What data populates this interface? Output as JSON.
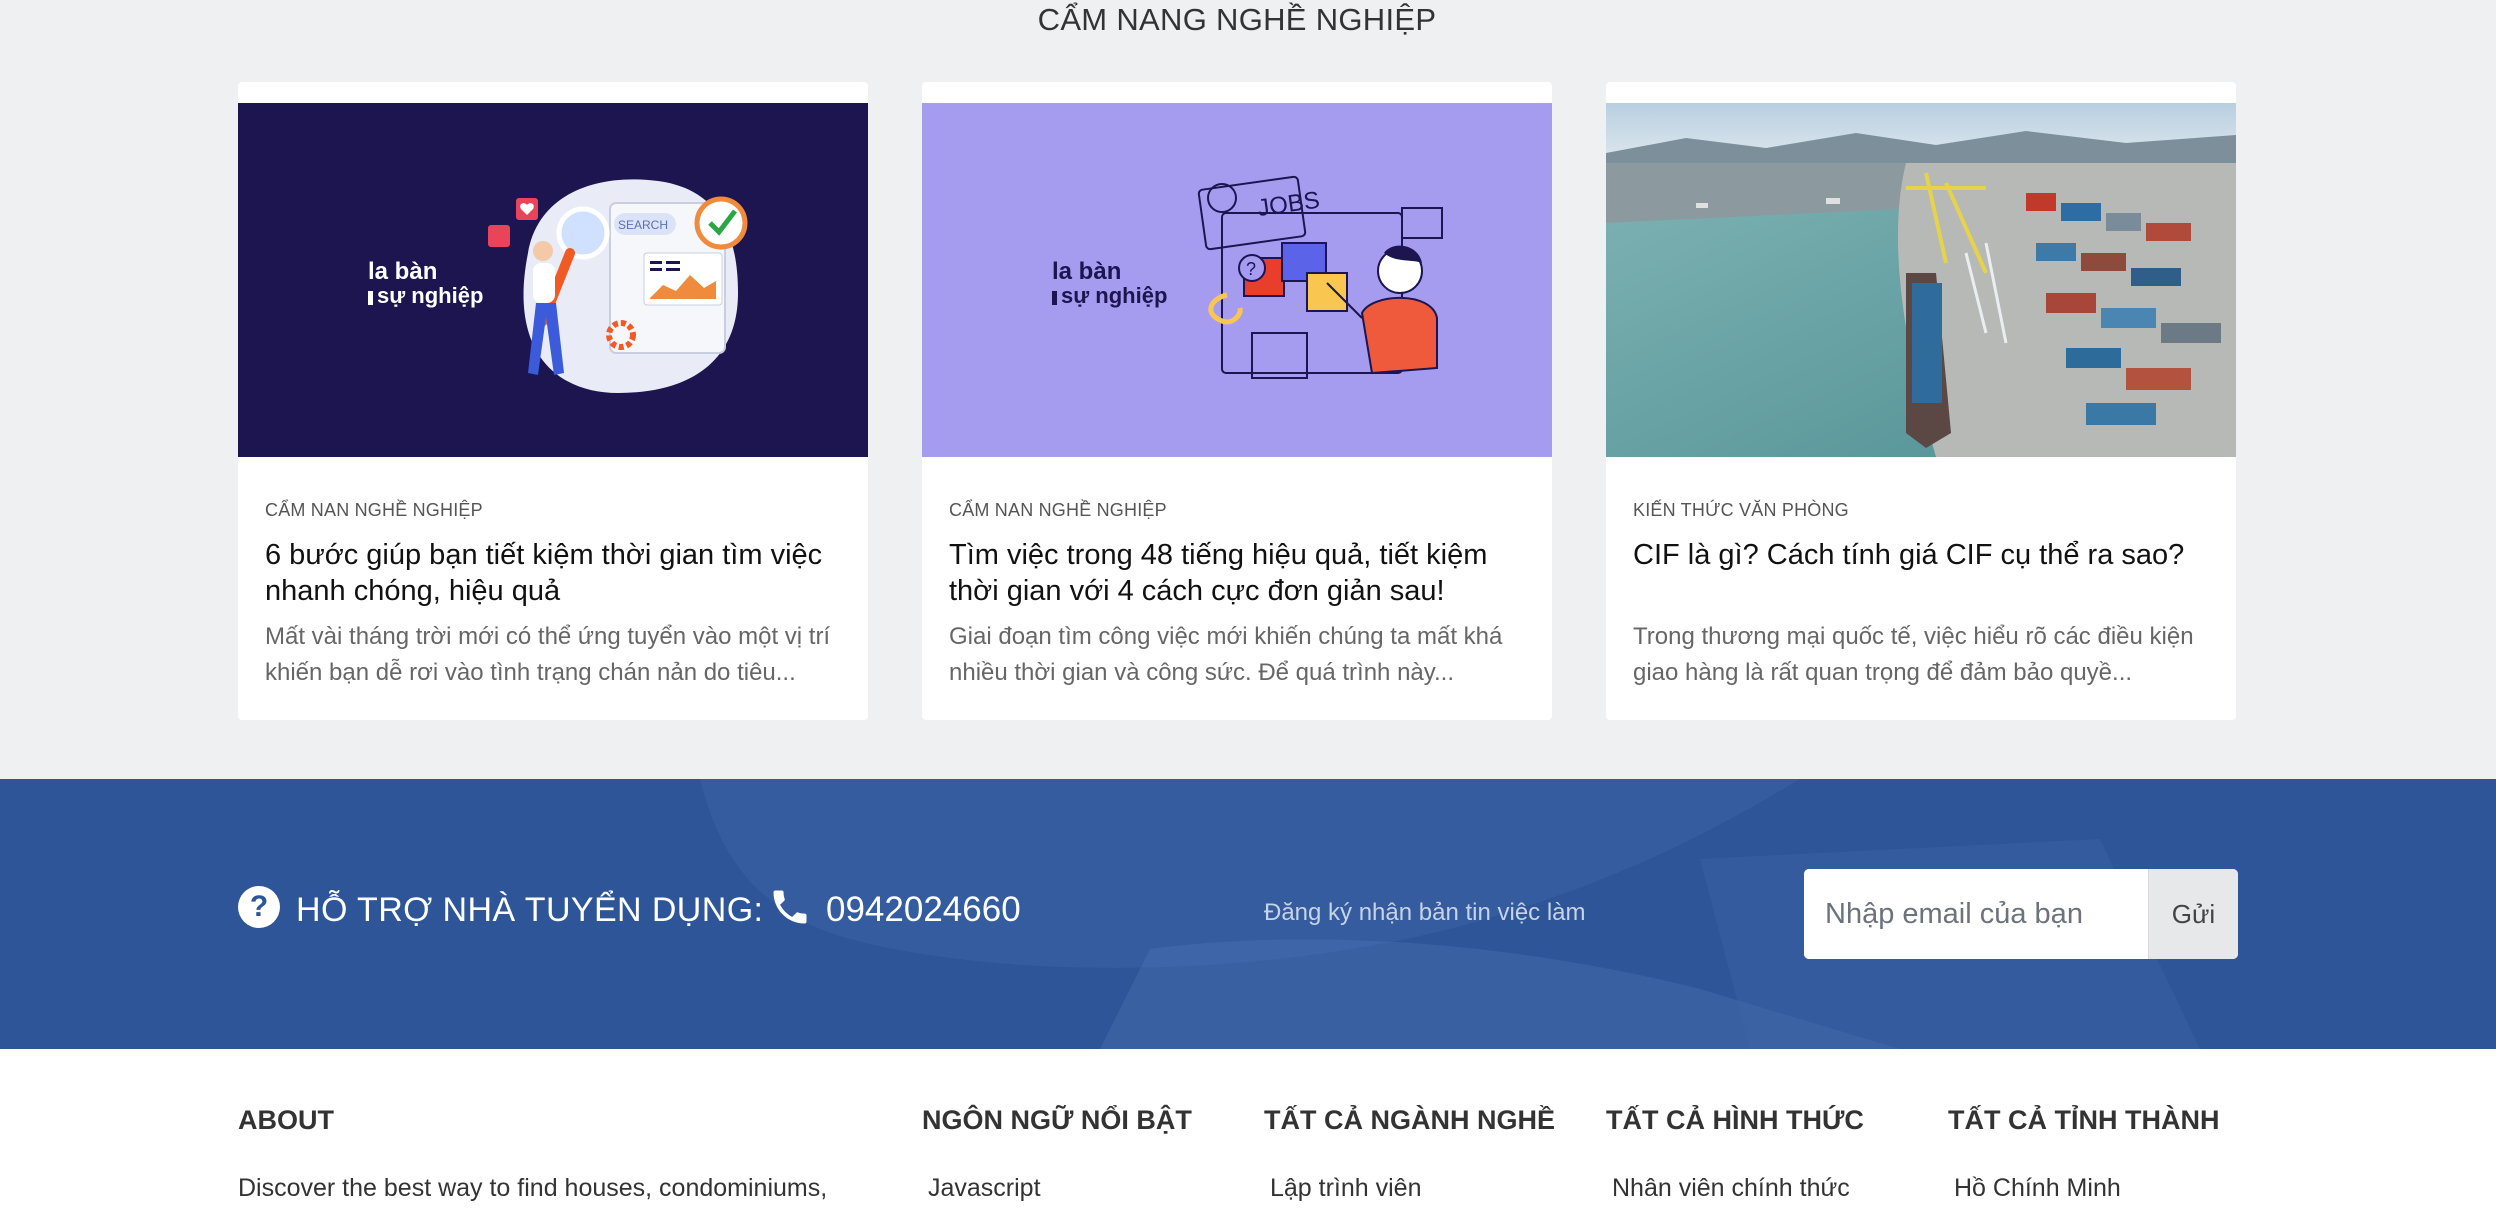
{
  "blog": {
    "section_title": "CẨM NANG NGHỀ NGHIỆP",
    "cards": [
      {
        "category": "CẨM NAN NGHỀ NGHIỆP",
        "title": "6 bước giúp bạn tiết kiệm thời gian tìm việc nhanh chóng, hiệu quả",
        "description": "Mất vài tháng trời mới có thể ứng tuyển vào một vị trí khiến bạn dễ rơi vào tình trạng chán nản do tiêu...",
        "image_brand": "la bàn sự nghiệp",
        "image_text": "SEARCH"
      },
      {
        "category": "CẨM NAN NGHỀ NGHIỆP",
        "title": "Tìm việc trong 48 tiếng hiệu quả, tiết kiệm thời gian với 4 cách cực đơn giản sau!",
        "description": "Giai đoạn tìm công việc mới khiến chúng ta mất khá nhiều thời gian và công sức. Để quá trình này...",
        "image_brand": "la bàn sự nghiệp",
        "image_text": "JOBS"
      },
      {
        "category": "KIẾN THỨC VĂN PHÒNG",
        "title": "CIF là gì? Cách tính giá CIF cụ thể ra sao?",
        "description": "Trong thương mại quốc tế, việc hiểu rõ các điều kiện giao hàng là rất quan trọng để đảm bảo quyề..."
      }
    ]
  },
  "support": {
    "help_icon": "question-circle-icon",
    "help_label": "HỖ TRỢ NHÀ TUYỂN DỤNG:",
    "phone_icon": "phone-icon",
    "phone_number": "0942024660",
    "newsletter_label": "Đăng ký nhận bản tin việc làm",
    "email_placeholder": "Nhập email của bạn",
    "send_label": "Gửi"
  },
  "footer": {
    "about": {
      "heading": "ABOUT",
      "text": "Discover the best way to find houses, condominiums,"
    },
    "columns": [
      {
        "heading": "NGÔN NGỮ NỔI BẬT",
        "first_item": "Javascript"
      },
      {
        "heading": "TẤT CẢ NGÀNH NGHỀ",
        "first_item": "Lập trình viên"
      },
      {
        "heading": "TẤT CẢ HÌNH THỨC",
        "first_item": "Nhân viên chính thức"
      },
      {
        "heading": "TẤT CẢ TỈNH THÀNH",
        "first_item": "Hồ Chính Minh"
      }
    ]
  },
  "colors": {
    "banner": "#2d5597",
    "page_bg": "#eef0f2",
    "card1_bg": "#1c1550",
    "card2_bg": "#a59cf0"
  }
}
